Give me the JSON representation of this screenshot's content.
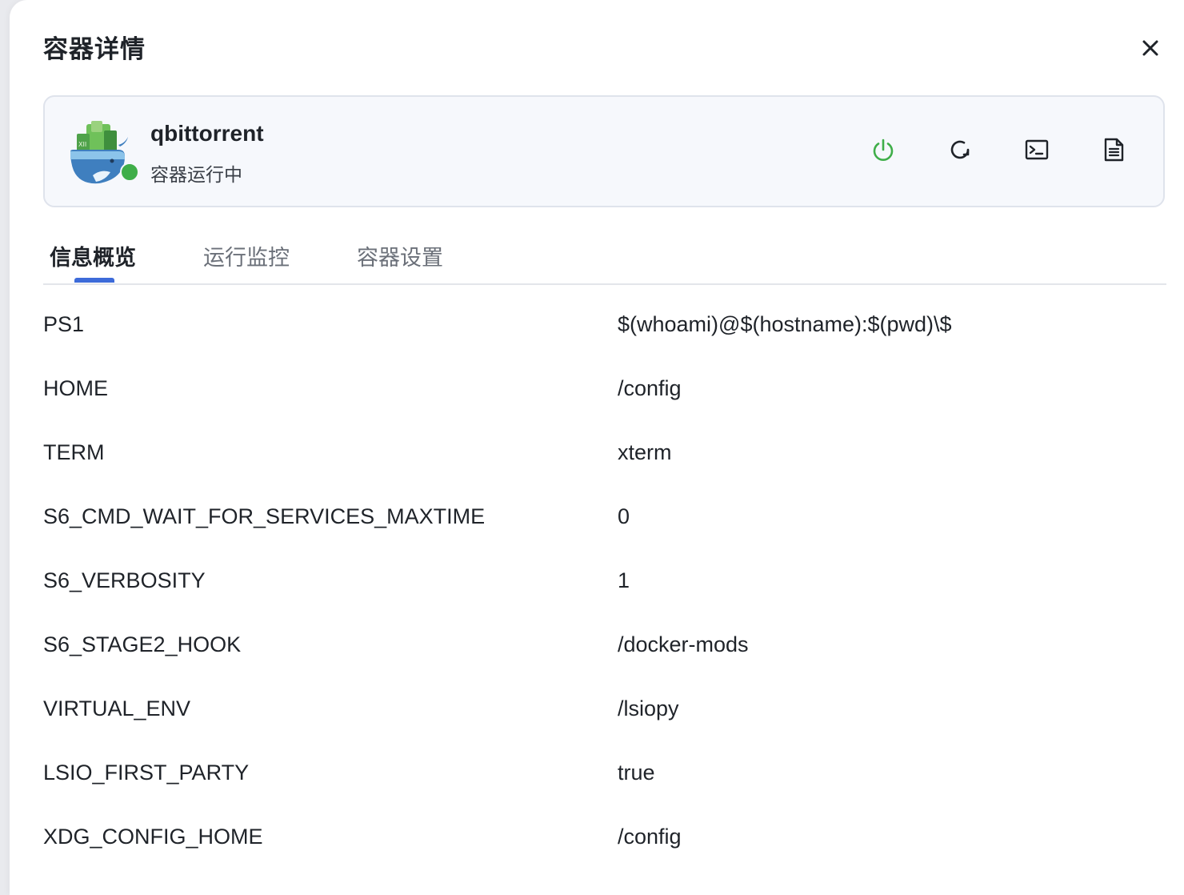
{
  "header": {
    "title": "容器详情",
    "close_icon": "close-icon"
  },
  "container": {
    "name": "qbittorrent",
    "status": "容器运行中",
    "status_color": "#3fae49",
    "logo_icon": "docker-whale-icon",
    "actions": [
      {
        "name": "power-button",
        "icon": "power-icon",
        "color": "#3fae49"
      },
      {
        "name": "restart-button",
        "icon": "refresh-icon",
        "color": "#1f2329"
      },
      {
        "name": "terminal-button",
        "icon": "terminal-icon",
        "color": "#1f2329"
      },
      {
        "name": "logs-button",
        "icon": "document-icon",
        "color": "#1f2329"
      }
    ]
  },
  "tabs": [
    {
      "label": "信息概览",
      "active": true
    },
    {
      "label": "运行监控",
      "active": false
    },
    {
      "label": "容器设置",
      "active": false
    }
  ],
  "accent_color": "#3d6bd9",
  "env": [
    {
      "key": "PS1",
      "value": "$(whoami)@$(hostname):$(pwd)\\$"
    },
    {
      "key": "HOME",
      "value": "/config"
    },
    {
      "key": "TERM",
      "value": "xterm"
    },
    {
      "key": "S6_CMD_WAIT_FOR_SERVICES_MAXTIME",
      "value": "0"
    },
    {
      "key": "S6_VERBOSITY",
      "value": "1"
    },
    {
      "key": "S6_STAGE2_HOOK",
      "value": "/docker-mods"
    },
    {
      "key": "VIRTUAL_ENV",
      "value": "/lsiopy"
    },
    {
      "key": "LSIO_FIRST_PARTY",
      "value": "true"
    },
    {
      "key": "XDG_CONFIG_HOME",
      "value": "/config"
    }
  ]
}
